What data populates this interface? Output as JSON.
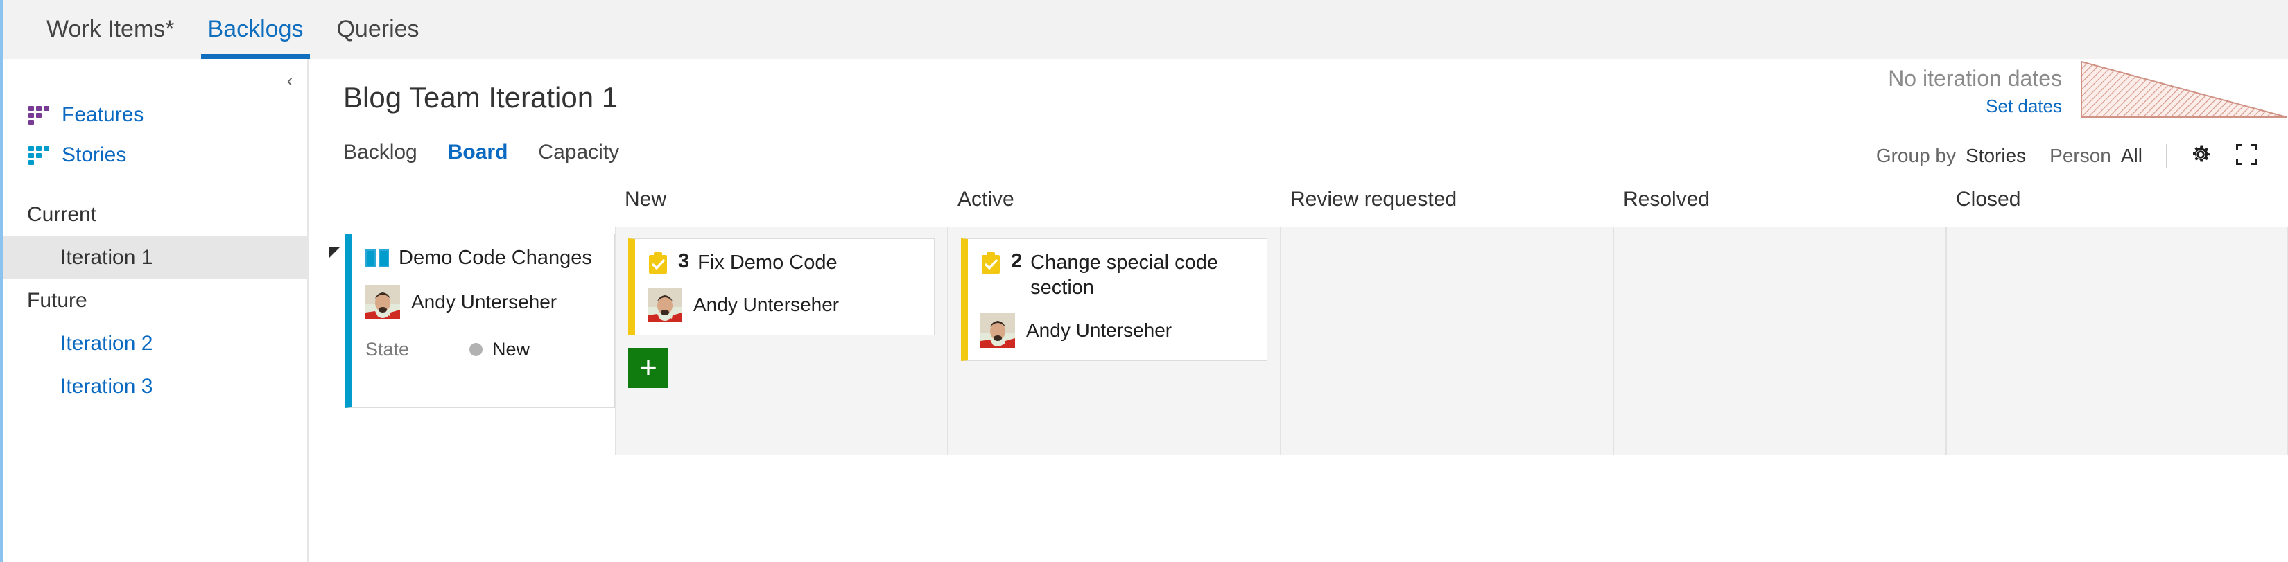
{
  "topnav": {
    "tabs": [
      {
        "label": "Work Items*",
        "active": false
      },
      {
        "label": "Backlogs",
        "active": true
      },
      {
        "label": "Queries",
        "active": false
      }
    ]
  },
  "sidebar": {
    "collapse_icon": "chevron-left-icon",
    "levels": [
      {
        "label": "Features",
        "icon": "backlog-level-icon",
        "color": "#773b93"
      },
      {
        "label": "Stories",
        "icon": "backlog-level-icon",
        "color": "#009ccc"
      }
    ],
    "iteration_groups": [
      {
        "label": "Current",
        "items": [
          {
            "label": "Iteration 1",
            "selected": true
          }
        ]
      },
      {
        "label": "Future",
        "items": [
          {
            "label": "Iteration 2",
            "selected": false
          },
          {
            "label": "Iteration 3",
            "selected": false
          }
        ]
      }
    ]
  },
  "main": {
    "title": "Blog Team Iteration 1",
    "dates": {
      "status": "No iteration dates",
      "set_dates_link": "Set dates",
      "chart_icon": "burndown-triangle-icon"
    },
    "subtabs": [
      {
        "label": "Backlog",
        "active": false
      },
      {
        "label": "Board",
        "active": true
      },
      {
        "label": "Capacity",
        "active": false
      }
    ],
    "controls": {
      "group_by_label": "Group by",
      "group_by_value": "Stories",
      "person_label": "Person",
      "person_value": "All",
      "settings_icon": "gear-icon",
      "fullscreen_icon": "fullscreen-icon"
    }
  },
  "board": {
    "columns": [
      {
        "label": "New"
      },
      {
        "label": "Active"
      },
      {
        "label": "Review requested"
      },
      {
        "label": "Resolved"
      },
      {
        "label": "Closed"
      }
    ],
    "swimlane": {
      "toggle_icon": "collapse-triangle-icon",
      "story": {
        "type_icon": "user-story-icon",
        "title": "Demo Code Changes",
        "assignee": "Andy Unterseher",
        "avatar_icon": "user-avatar",
        "state_label": "State",
        "state_value": "New",
        "accent_color": "#009ccc"
      },
      "cells": {
        "new": {
          "cards": [
            {
              "type_icon": "task-icon",
              "count": "3",
              "title": "Fix Demo Code",
              "assignee": "Andy Unterseher",
              "accent_color": "#f2c811"
            }
          ],
          "add_button": "+"
        },
        "active": {
          "cards": [
            {
              "type_icon": "task-icon",
              "count": "2",
              "title": "Change special code section",
              "assignee": "Andy Unterseher",
              "accent_color": "#f2c811"
            }
          ]
        },
        "review_requested": {
          "cards": []
        },
        "resolved": {
          "cards": []
        },
        "closed": {
          "cards": []
        }
      }
    }
  },
  "colors": {
    "accent": "#0a69c0",
    "story": "#009ccc",
    "task": "#f2c811",
    "feature": "#773b93",
    "add": "#107c10"
  }
}
